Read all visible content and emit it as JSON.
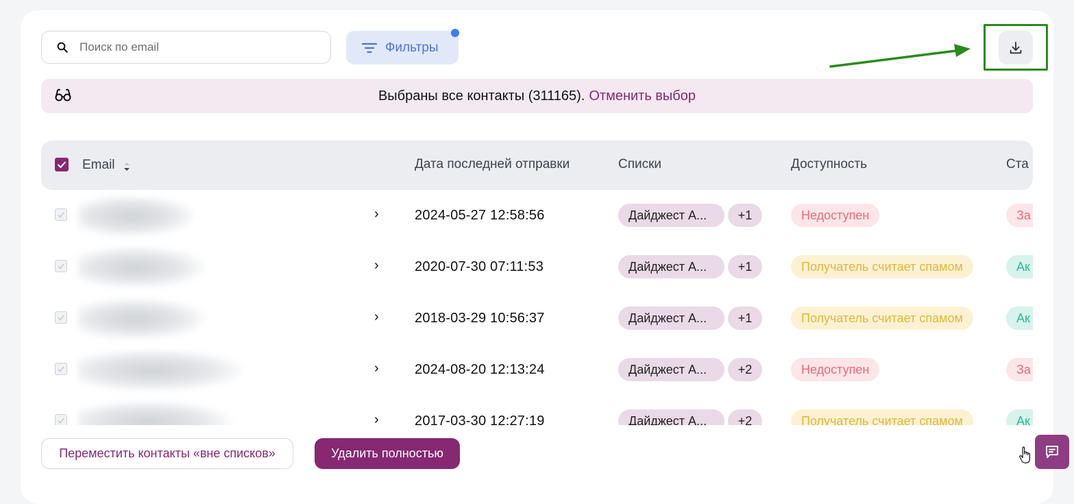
{
  "search": {
    "placeholder": "Поиск по email"
  },
  "filters": {
    "label": "Фильтры"
  },
  "banner": {
    "text": "Выбраны все контакты (311165).",
    "cancel_label": "Отменить выбор"
  },
  "table": {
    "columns": {
      "email": "Email",
      "last_sent": "Дата последней отправки",
      "lists": "Списки",
      "availability": "Доступность",
      "status": "Ста"
    },
    "rows": [
      {
        "date": "2024-05-27 12:58:56",
        "list": "Дайджест А...",
        "more": "+1",
        "availability": "Недоступен",
        "status": "За"
      },
      {
        "date": "2020-07-30 07:11:53",
        "list": "Дайджест А...",
        "more": "+1",
        "availability": "Получатель считает спамом",
        "status": "Ак"
      },
      {
        "date": "2018-03-29 10:56:37",
        "list": "Дайджест А...",
        "more": "+1",
        "availability": "Получатель считает спамом",
        "status": "Ак"
      },
      {
        "date": "2024-08-20 12:13:24",
        "list": "Дайджест А...",
        "more": "+2",
        "availability": "Недоступен",
        "status": "За"
      },
      {
        "date": "2017-03-30 12:27:19",
        "list": "Дайджест А...",
        "more": "+2",
        "availability": "Получатель считает спамом",
        "status": "Ак"
      }
    ]
  },
  "actions": {
    "move_label": "Переместить контакты «вне списков»",
    "delete_label": "Удалить полностью"
  },
  "colors": {
    "accent": "#862872",
    "filters_blue": "#4c73d8",
    "highlight_green": "#2a8a1a"
  }
}
